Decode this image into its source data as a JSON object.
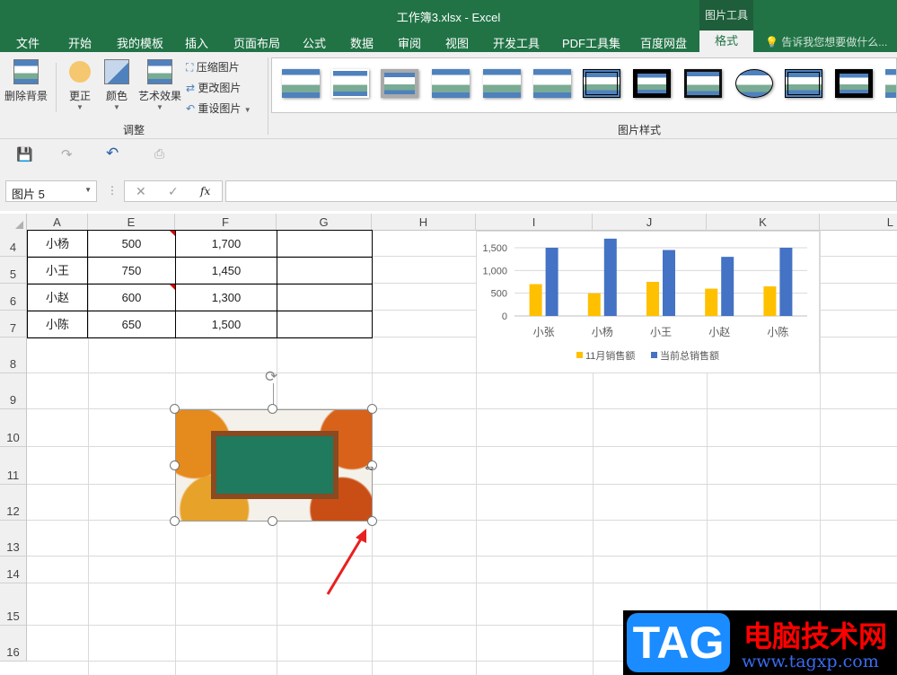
{
  "window": {
    "title": "工作簿3.xlsx - Excel",
    "context_tab_group": "图片工具"
  },
  "tabs": [
    "文件",
    "开始",
    "我的模板",
    "插入",
    "页面布局",
    "公式",
    "数据",
    "审阅",
    "视图",
    "开发工具",
    "PDF工具集",
    "百度网盘"
  ],
  "active_tab": "格式",
  "tell_me": "告诉我您想要做什么...",
  "ribbon": {
    "remove_bg": "删除背景",
    "corrections": "更正",
    "color": "颜色",
    "artistic": "艺术效果",
    "compress": "压缩图片",
    "change": "更改图片",
    "reset": "重设图片",
    "group_adjust": "调整",
    "group_styles": "图片样式"
  },
  "name_box": "图片 5",
  "fx": "fx",
  "columns": [
    "A",
    "E",
    "F",
    "G",
    "H",
    "I",
    "J",
    "K",
    "L"
  ],
  "rows": [
    "4",
    "5",
    "6",
    "7",
    "8",
    "9",
    "10",
    "11",
    "12",
    "13",
    "14",
    "15",
    "16"
  ],
  "table": [
    [
      "小杨",
      "500",
      "1,700"
    ],
    [
      "小王",
      "750",
      "1,450"
    ],
    [
      "小赵",
      "600",
      "1,300"
    ],
    [
      "小陈",
      "650",
      "1,500"
    ]
  ],
  "colors": {
    "excel_green": "#217346",
    "series1": "#FFC000",
    "series2": "#4472C4"
  },
  "chart_data": {
    "type": "bar",
    "categories": [
      "小张",
      "小杨",
      "小王",
      "小赵",
      "小陈"
    ],
    "series": [
      {
        "name": "11月销售额",
        "values": [
          700,
          500,
          750,
          600,
          650
        ]
      },
      {
        "name": "当前总销售额",
        "values": [
          1500,
          1700,
          1450,
          1300,
          1500
        ]
      }
    ],
    "yticks": [
      "0",
      "500",
      "1,000",
      "1,500"
    ],
    "ylim": [
      0,
      1750
    ],
    "legend": "bottom",
    "grid": true
  },
  "watermark": {
    "logo": "TAG",
    "name": "电脑技术网",
    "url": "www.tagxp.com"
  }
}
